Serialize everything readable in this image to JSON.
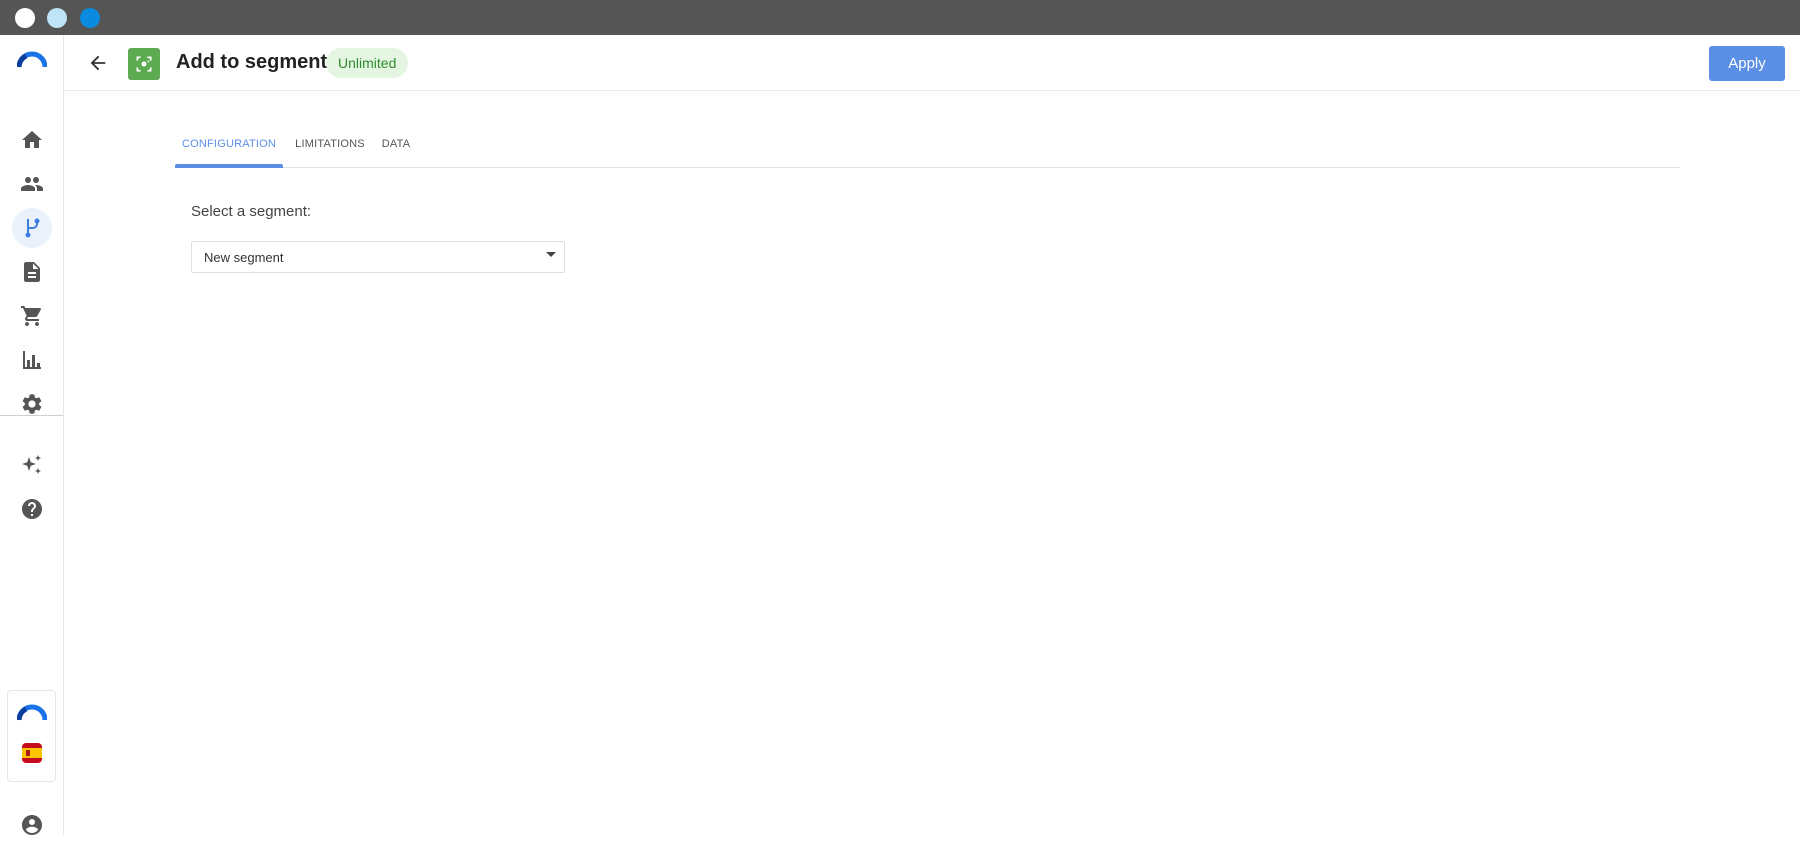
{
  "window": {
    "controls": [
      "close-dot",
      "minimize-dot",
      "maximize-dot"
    ]
  },
  "sidebar": {
    "items": [
      {
        "name": "home",
        "icon": "home-icon",
        "active": false
      },
      {
        "name": "contacts",
        "icon": "people-icon",
        "active": false
      },
      {
        "name": "workflows",
        "icon": "flow-icon",
        "active": true
      },
      {
        "name": "content",
        "icon": "document-icon",
        "active": false
      },
      {
        "name": "ecommerce",
        "icon": "cart-icon",
        "active": false
      },
      {
        "name": "reports",
        "icon": "bar-chart-icon",
        "active": false
      },
      {
        "name": "settings",
        "icon": "gear-icon",
        "active": false
      },
      {
        "name": "ai",
        "icon": "sparkles-icon",
        "active": false
      },
      {
        "name": "help",
        "icon": "help-icon",
        "active": false
      }
    ],
    "bottom": {
      "brand_icon": "brand-logo-icon",
      "language_icon": "spain-flag-icon",
      "account_icon": "account-icon"
    },
    "accent": "#3d7de0"
  },
  "header": {
    "title": "Add to segment",
    "badge": "Unlimited",
    "apply_label": "Apply",
    "app_icon_color": "#5cab52"
  },
  "tabs": [
    {
      "label": "CONFIGURATION",
      "active": true
    },
    {
      "label": "LIMITATIONS",
      "active": false
    },
    {
      "label": "DATA",
      "active": false
    }
  ],
  "form": {
    "segment_label": "Select a segment:",
    "segment_value": "New segment"
  }
}
